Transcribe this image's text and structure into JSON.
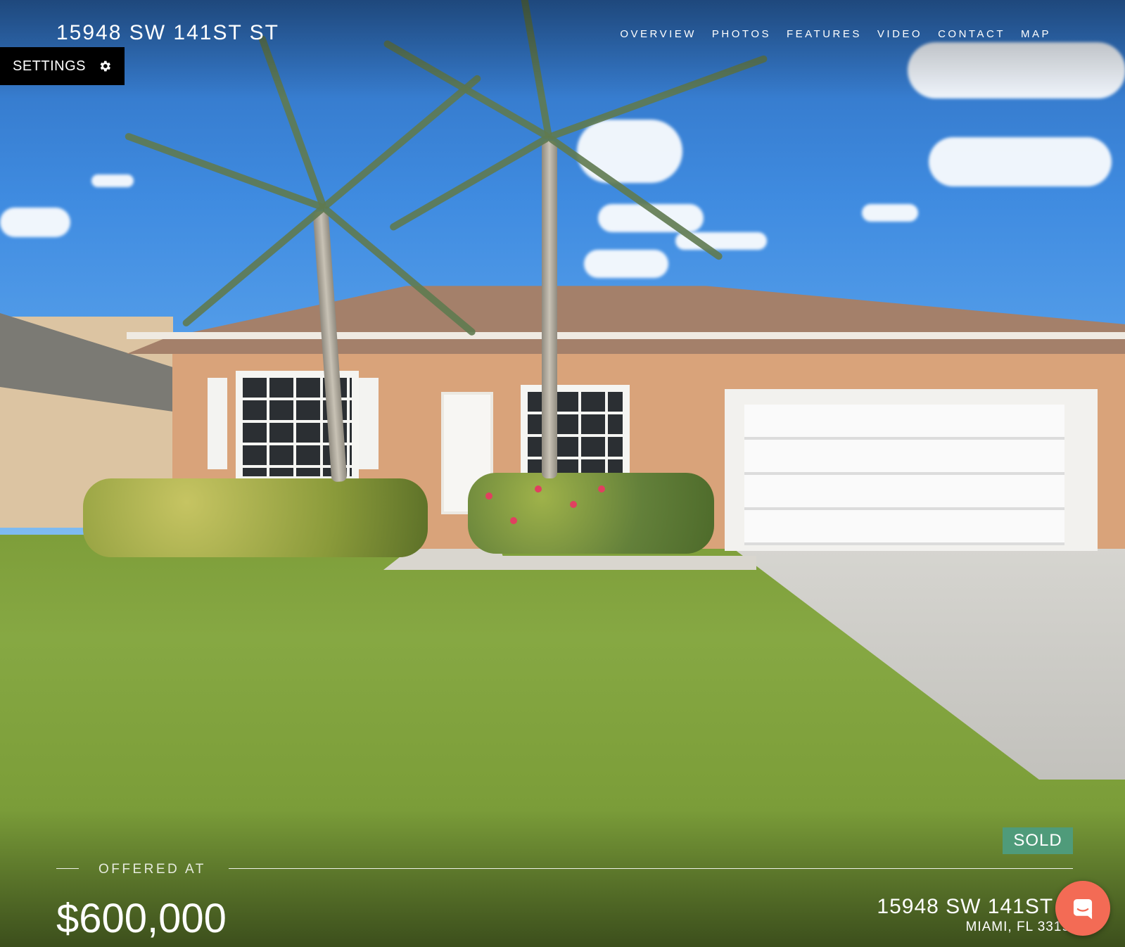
{
  "header": {
    "title": "15948 SW 141ST ST"
  },
  "nav": {
    "items": [
      {
        "label": "OVERVIEW"
      },
      {
        "label": "PHOTOS"
      },
      {
        "label": "FEATURES"
      },
      {
        "label": "VIDEO"
      },
      {
        "label": "CONTACT"
      },
      {
        "label": "MAP"
      }
    ]
  },
  "settings": {
    "label": "SETTINGS",
    "icon": "gear-icon"
  },
  "listing": {
    "status_badge": "SOLD",
    "offered_label": "OFFERED AT",
    "price": "$600,000",
    "address_line1": "15948 SW 141ST S",
    "address_line2": "MIAMI, FL 3319"
  },
  "chat": {
    "icon": "chat-icon",
    "color": "#f36b55"
  },
  "colors": {
    "sold_badge": "#4f9b7a",
    "settings_bg": "#000000"
  }
}
